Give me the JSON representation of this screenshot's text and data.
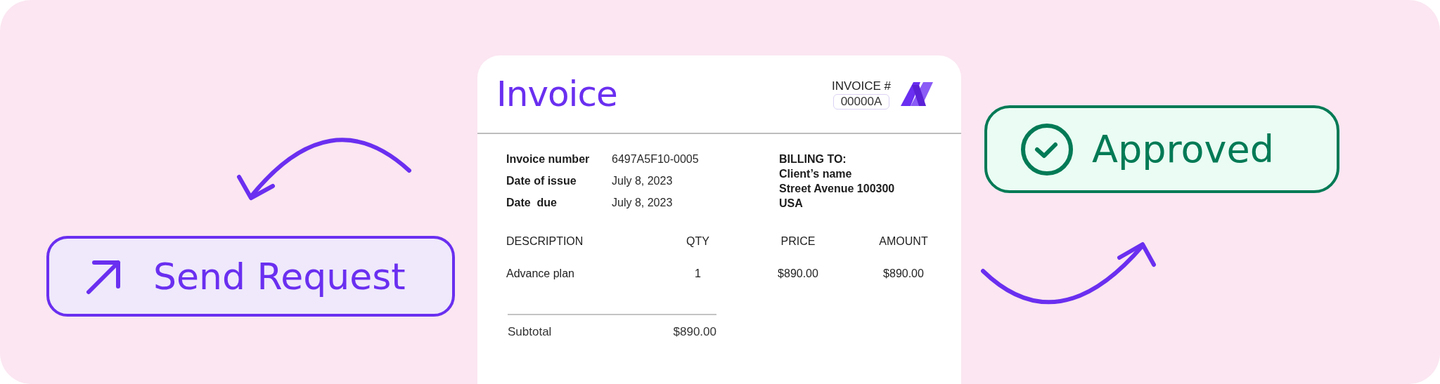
{
  "send_button": {
    "label": "Send Request"
  },
  "approved_badge": {
    "label": "Approved"
  },
  "invoice": {
    "title": "Invoice",
    "number_label": "INVOICE #",
    "number": "00000A",
    "details": [
      {
        "label": "Invoice number",
        "value": "6497A5F10-0005"
      },
      {
        "label": "Date of issue",
        "value": "July 8, 2023"
      },
      {
        "label": "Date  due",
        "value": "July 8, 2023"
      }
    ],
    "billing": {
      "heading": "BILLING TO:",
      "lines": [
        "Client’s name",
        "Street Avenue 100300",
        "USA"
      ]
    },
    "table": {
      "columns": [
        "DESCRIPTION",
        "QTY",
        "PRICE",
        "AMOUNT"
      ],
      "rows": [
        [
          "Advance plan",
          "1",
          "$890.00",
          "$890.00"
        ]
      ]
    },
    "subtotal": {
      "label": "Subtotal",
      "value": "$890.00"
    }
  }
}
